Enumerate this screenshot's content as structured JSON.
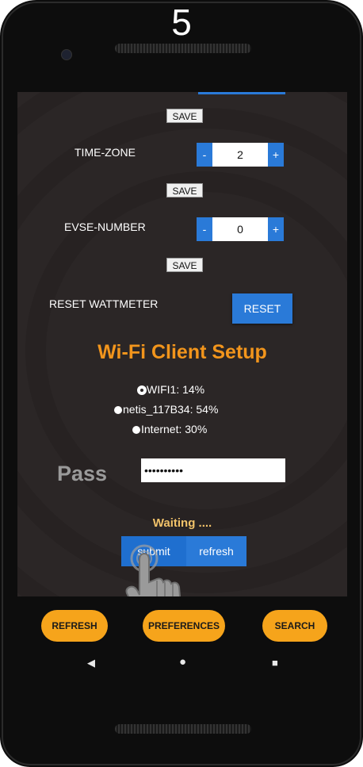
{
  "overlay": {
    "step_number": "5"
  },
  "settings": {
    "save_label": "SAVE",
    "time_zone": {
      "label": "TIME-ZONE",
      "minus": "-",
      "value": "2",
      "plus": "+"
    },
    "evse_number": {
      "label": "EVSE-NUMBER",
      "minus": "-",
      "value": "0",
      "plus": "+"
    },
    "reset_wattmeter": {
      "label": "RESET WATTMETER",
      "button": "RESET"
    }
  },
  "wifi": {
    "title": "Wi-Fi Client Setup",
    "networks": [
      {
        "name": "WIFI1: 14%",
        "selected": true
      },
      {
        "name": "netis_117B34: 54%",
        "selected": false
      },
      {
        "name": "Internet: 30%",
        "selected": false
      }
    ],
    "pass_label": "Pass",
    "pass_value": "••••••••••",
    "status": "Waiting ....",
    "submit_label": "submit",
    "refresh_label": "refresh"
  },
  "bottom_nav": {
    "refresh": "REFRESH",
    "preferences": "PREFERENCES",
    "search": "SEARCH"
  },
  "system_nav": {
    "back_glyph": "◀",
    "home_glyph": "●",
    "recents_glyph": "■"
  },
  "colors": {
    "accent_blue": "#2a7ad8",
    "title_orange": "#f2951c",
    "nav_orange": "#f6a41b",
    "screen_bg": "#2b2626"
  }
}
